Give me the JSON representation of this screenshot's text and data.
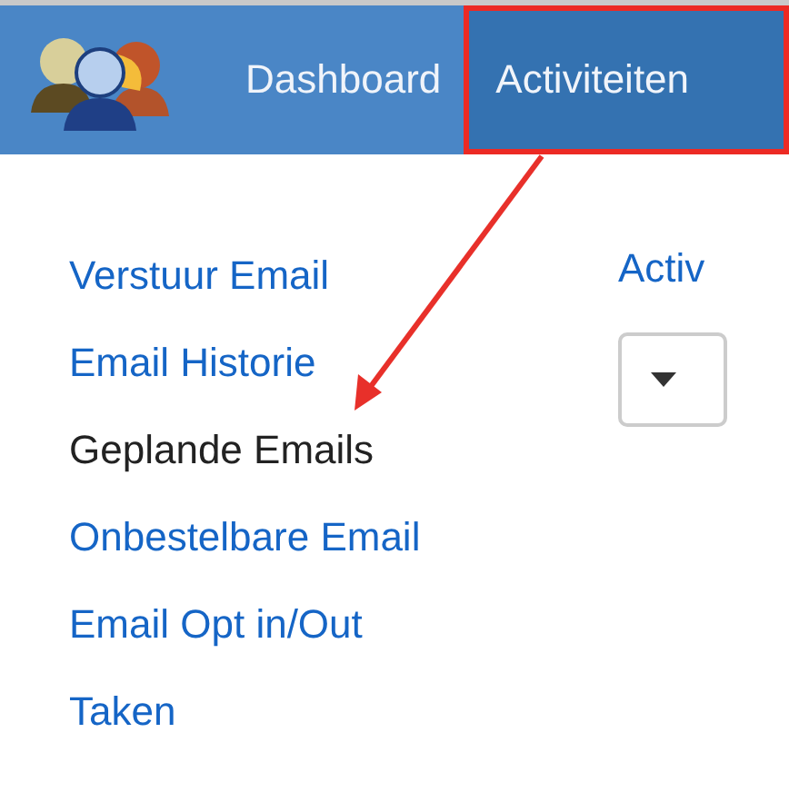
{
  "navbar": {
    "items": [
      {
        "label": "Dashboard",
        "selected": false
      },
      {
        "label": "Activiteiten",
        "selected": true
      }
    ]
  },
  "sidebar": {
    "items": [
      {
        "label": "Verstuur Email",
        "selected": false
      },
      {
        "label": "Email Historie",
        "selected": false
      },
      {
        "label": "Geplande Emails",
        "selected": true
      },
      {
        "label": "Onbestelbare Email",
        "selected": false
      },
      {
        "label": "Email Opt in/Out",
        "selected": false
      },
      {
        "label": "Taken",
        "selected": false
      }
    ]
  },
  "main": {
    "heading": "Activ"
  }
}
